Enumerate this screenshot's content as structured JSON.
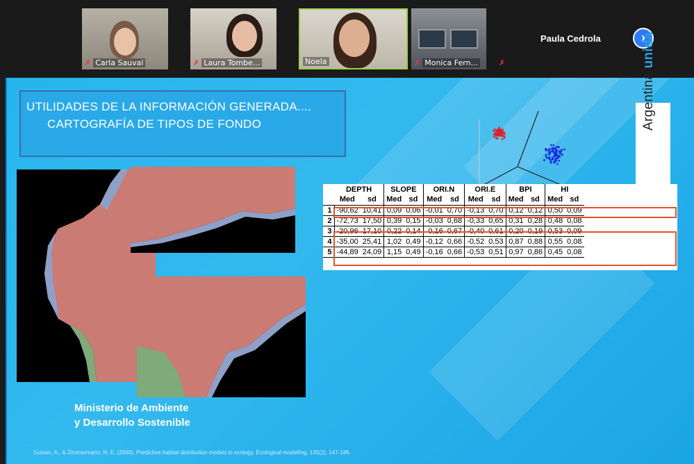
{
  "participants": [
    {
      "name": "Carla Sauval",
      "muted": true
    },
    {
      "name": "Laura Tombe...",
      "muted": true
    },
    {
      "name": "Noela",
      "muted": false
    },
    {
      "name": "Monica Fern...",
      "muted": true
    },
    {
      "name": "Paula Cedrola",
      "muted": true
    }
  ],
  "icons": {
    "mic": "✗",
    "next": "›"
  },
  "slide": {
    "title_line1": "UTILIDADES DE LA INFORMACIÓN GENERADA....",
    "title_line2": "CARTOGRAFÍA DE TIPOS DE FONDO",
    "ministry_line1": "Ministerio de Ambiente",
    "ministry_line2": "y Desarrollo Sostenible",
    "citation": "Guisan, A., & Zimmermann, N. E. (2000). Predictive habitat distribution models in ecology. Ecological modelling, 135(2), 147-186.",
    "brand_prefix": "Argentina ",
    "brand_suffix": "unida"
  },
  "table": {
    "groups": [
      "DEPTH",
      "SLOPE",
      "ORI.N",
      "ORI.E",
      "BPI",
      "HI"
    ],
    "subheaders": [
      "Med",
      "sd"
    ],
    "rows": [
      {
        "id": "1",
        "values": [
          "-90,62",
          "10,41",
          "0,09",
          "0,06",
          "-0,01",
          "0,70",
          "-0,13",
          "0,70",
          "0,12",
          "0,12",
          "0,50",
          "0,09"
        ]
      },
      {
        "id": "2",
        "values": [
          "-72,73",
          "17,50",
          "0,39",
          "0,15",
          "-0,03",
          "0,68",
          "-0,33",
          "0,65",
          "0,31",
          "0,28",
          "0,48",
          "0,08"
        ]
      },
      {
        "id": "3",
        "values": [
          "-20,96",
          "17,10",
          "0,22",
          "0,14",
          "0,16",
          "0,67",
          "-0,40",
          "0,61",
          "0,20",
          "0,19",
          "0,53",
          "0,09"
        ]
      },
      {
        "id": "4",
        "values": [
          "-35,00",
          "25,41",
          "1,02",
          "0,49",
          "-0,12",
          "0,66",
          "-0,52",
          "0,53",
          "0,87",
          "0,88",
          "0,55",
          "0,08"
        ]
      },
      {
        "id": "5",
        "values": [
          "-44,89",
          "24,09",
          "1,15",
          "0,49",
          "-0,16",
          "0,66",
          "-0,53",
          "0,51",
          "0,97",
          "0,86",
          "0,45",
          "0,08"
        ]
      }
    ]
  },
  "colors": {
    "slide_bg": "#27b5ee",
    "active_speaker_border": "#9bd24a",
    "highlight": "#e0532b",
    "map_red": "#c97b74",
    "map_green": "#7faa7a",
    "map_blue": "#8fa0c8",
    "cluster_red": "#e0202a",
    "cluster_blue": "#1a2ee0",
    "cluster_green": "#20a030"
  }
}
